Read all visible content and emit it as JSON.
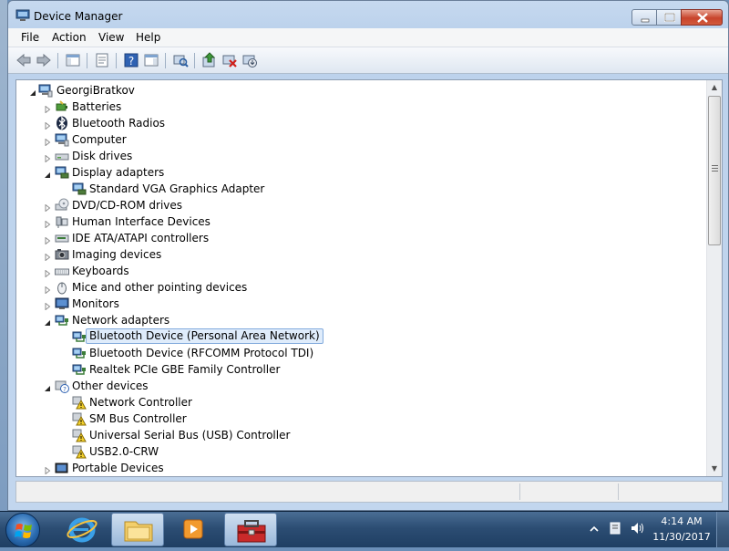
{
  "window": {
    "title": "Device Manager"
  },
  "menu": [
    "File",
    "Action",
    "View",
    "Help"
  ],
  "toolbar": {
    "buttons": [
      "back-icon",
      "forward-icon",
      "show-hide-console-tree-icon",
      "properties-sheet-icon",
      "help-icon",
      "action-pane-icon",
      "scan-hardware-icon",
      "update-driver-icon",
      "disable-device-icon",
      "uninstall-device-icon"
    ]
  },
  "tree": {
    "root": "GeorgiBratkov",
    "items": [
      {
        "label": "Batteries",
        "level": 1,
        "expanded": false,
        "icon": "battery-icon"
      },
      {
        "label": "Bluetooth Radios",
        "level": 1,
        "expanded": false,
        "icon": "bluetooth-icon"
      },
      {
        "label": "Computer",
        "level": 1,
        "expanded": false,
        "icon": "computer-icon"
      },
      {
        "label": "Disk drives",
        "level": 1,
        "expanded": false,
        "icon": "disk-drive-icon"
      },
      {
        "label": "Display adapters",
        "level": 1,
        "expanded": true,
        "icon": "display-adapter-icon"
      },
      {
        "label": "Standard VGA Graphics Adapter",
        "level": 2,
        "icon": "display-adapter-icon"
      },
      {
        "label": "DVD/CD-ROM drives",
        "level": 1,
        "expanded": false,
        "icon": "dvd-drive-icon"
      },
      {
        "label": "Human Interface Devices",
        "level": 1,
        "expanded": false,
        "icon": "hid-icon"
      },
      {
        "label": "IDE ATA/ATAPI controllers",
        "level": 1,
        "expanded": false,
        "icon": "ide-controller-icon"
      },
      {
        "label": "Imaging devices",
        "level": 1,
        "expanded": false,
        "icon": "camera-icon"
      },
      {
        "label": "Keyboards",
        "level": 1,
        "expanded": false,
        "icon": "keyboard-icon"
      },
      {
        "label": "Mice and other pointing devices",
        "level": 1,
        "expanded": false,
        "icon": "mouse-icon"
      },
      {
        "label": "Monitors",
        "level": 1,
        "expanded": false,
        "icon": "monitor-icon"
      },
      {
        "label": "Network adapters",
        "level": 1,
        "expanded": true,
        "icon": "network-adapter-icon"
      },
      {
        "label": "Bluetooth Device (Personal Area Network)",
        "level": 2,
        "icon": "network-adapter-icon",
        "selected": true
      },
      {
        "label": "Bluetooth Device (RFCOMM Protocol TDI)",
        "level": 2,
        "icon": "network-adapter-icon"
      },
      {
        "label": "Realtek PCIe GBE Family Controller",
        "level": 2,
        "icon": "network-adapter-icon"
      },
      {
        "label": "Other devices",
        "level": 1,
        "expanded": true,
        "icon": "unknown-device-icon"
      },
      {
        "label": "Network Controller",
        "level": 2,
        "icon": "warning-device-icon"
      },
      {
        "label": "SM Bus Controller",
        "level": 2,
        "icon": "warning-device-icon"
      },
      {
        "label": "Universal Serial Bus (USB) Controller",
        "level": 2,
        "icon": "warning-device-icon"
      },
      {
        "label": "USB2.0-CRW",
        "level": 2,
        "icon": "warning-device-icon"
      },
      {
        "label": "Portable Devices",
        "level": 1,
        "expanded": false,
        "icon": "portable-device-icon"
      }
    ]
  },
  "taskbar": {
    "apps": [
      "internet-explorer-icon",
      "file-explorer-icon",
      "media-player-icon",
      "device-manager-toolbox-icon"
    ],
    "time": "4:14 AM",
    "date": "11/30/2017"
  }
}
